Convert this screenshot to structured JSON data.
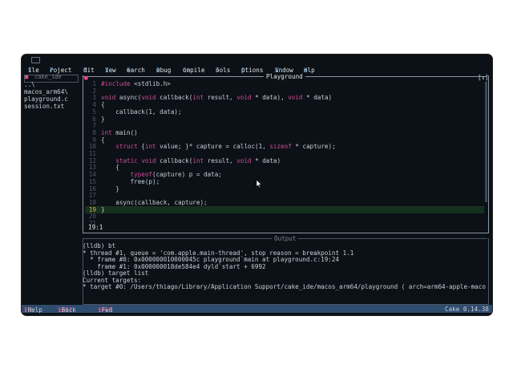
{
  "menubar": {
    "items": [
      "File",
      "Project",
      "Edit",
      "View",
      "Search",
      "Debug",
      "Compile",
      "Tools",
      "Options",
      "Window",
      "Help"
    ]
  },
  "sidebar": {
    "close": "■",
    "title": "cake_ide",
    "items": [
      "..\\",
      "macos_arm64\\",
      "playground.c",
      "session.txt"
    ]
  },
  "editor": {
    "close": "■",
    "title": "Playground",
    "zoom": "[↕]",
    "status": "19:1",
    "breakpoint_line": "19",
    "lines": [
      {
        "n": "1",
        "code": "#include <stdlib.h>"
      },
      {
        "n": "2",
        "code": ""
      },
      {
        "n": "3",
        "code": "void async(void callback(int result, void * data), void * data)"
      },
      {
        "n": "4",
        "code": "{"
      },
      {
        "n": "5",
        "code": "    callback(1, data);"
      },
      {
        "n": "6",
        "code": "}"
      },
      {
        "n": "7",
        "code": ""
      },
      {
        "n": "8",
        "code": "int main()"
      },
      {
        "n": "9",
        "code": "{"
      },
      {
        "n": "10",
        "code": "    struct {int value; }* capture = calloc(1, sizeof * capture);"
      },
      {
        "n": "11",
        "code": ""
      },
      {
        "n": "12",
        "code": "    static void callback(int result, void * data)"
      },
      {
        "n": "13",
        "code": "    {"
      },
      {
        "n": "14",
        "code": "        typeof(capture) p = data;"
      },
      {
        "n": "15",
        "code": "        free(p);"
      },
      {
        "n": "16",
        "code": "    }"
      },
      {
        "n": "17",
        "code": ""
      },
      {
        "n": "18",
        "code": "    async(callback, capture);"
      },
      {
        "n": "19",
        "code": "}"
      },
      {
        "n": "20",
        "code": ""
      },
      {
        "n": "21",
        "code": ""
      }
    ]
  },
  "output": {
    "close": "■",
    "title": "Output",
    "lines": [
      "(lldb) bt",
      "* thread #1, queue = 'com.apple.main-thread', stop reason = breakpoint 1.1",
      "  * frame #0: 0x000000010000045c playground`main at playground.c:19:24",
      "    frame #1: 0x000000018de584e4 dyld`start + 6992",
      "(lldb) target list",
      "Current targets:",
      "* target #0: /Users/thiago/Library/Application Support/cake_ide/macos_arm64/playground ( arch=arm64-apple-maco"
    ]
  },
  "footer": {
    "items": [
      {
        "key": "F1",
        "label": ":Help"
      },
      {
        "key": "S+F2",
        "label": ":Back"
      },
      {
        "key": "S+F3",
        "label": ":Fwd"
      }
    ],
    "version": "Cake 0.14.38"
  },
  "colors": {
    "background": "#0b1116",
    "accent_pink": "#e04d8b",
    "footer_bg": "#2f4b6e",
    "current_line": "#16301f"
  }
}
